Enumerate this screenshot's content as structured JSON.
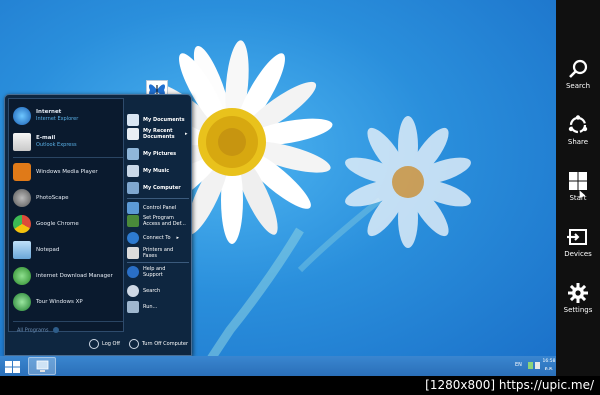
{
  "charms": [
    {
      "label": "Search",
      "icon": "search-icon"
    },
    {
      "label": "Share",
      "icon": "share-icon"
    },
    {
      "label": "Start",
      "icon": "windows-logo-icon"
    },
    {
      "label": "Devices",
      "icon": "devices-icon"
    },
    {
      "label": "Settings",
      "icon": "gear-icon"
    }
  ],
  "start_menu": {
    "pinned": [
      {
        "title": "Internet",
        "subtitle": "Internet Explorer",
        "icon": "internet-explorer-icon",
        "color": "#2b78d8"
      },
      {
        "title": "E-mail",
        "subtitle": "Outlook Express",
        "icon": "email-icon",
        "color": "#e6e6e6"
      }
    ],
    "recent": [
      {
        "label": "Windows Media Player",
        "icon": "media-player-icon",
        "color": "#e07a18"
      },
      {
        "label": "PhotoScape",
        "icon": "photoscape-icon",
        "color": "#777777"
      },
      {
        "label": "Google Chrome",
        "icon": "chrome-icon",
        "color": "#dd4b39"
      },
      {
        "label": "Notepad",
        "icon": "notepad-icon",
        "color": "#8ec0e8"
      },
      {
        "label": "Internet Download Manager",
        "icon": "idm-icon",
        "color": "#3aa53a"
      },
      {
        "label": "Tour Windows XP",
        "icon": "tour-xp-icon",
        "color": "#2d9c3a"
      }
    ],
    "all_programs": "All Programs",
    "right": [
      {
        "label": "My Documents",
        "icon": "documents-icon"
      },
      {
        "label": "My Recent Documents",
        "icon": "recent-documents-icon"
      },
      {
        "label": "My Pictures",
        "icon": "pictures-icon"
      },
      {
        "label": "My Music",
        "icon": "music-icon"
      },
      {
        "label": "My Computer",
        "icon": "computer-icon"
      },
      {
        "label": "Control Panel",
        "icon": "control-panel-icon"
      },
      {
        "label": "Set Program Access and Def...",
        "icon": "program-access-icon"
      },
      {
        "label": "Connect To",
        "icon": "connect-icon"
      },
      {
        "label": "Printers and Faxes",
        "icon": "printer-icon"
      },
      {
        "label": "Help and Support",
        "icon": "help-icon"
      },
      {
        "label": "Search",
        "icon": "search-icon"
      },
      {
        "label": "Run...",
        "icon": "run-icon"
      }
    ],
    "log_off": "Log Off",
    "turn_off": "Turn Off Computer"
  },
  "taskbar": {
    "language": "EN",
    "time": "16:58",
    "date": "ต.ค."
  },
  "watermark": "[1280x800] https://upic.me/",
  "colors": {
    "desktop": "#2a8fdc",
    "charms_bg": "#101010",
    "start_menu_bg": "#0e2640",
    "taskbar": "#3a86d0"
  }
}
